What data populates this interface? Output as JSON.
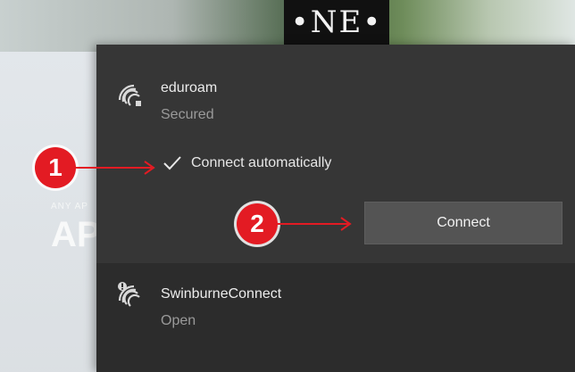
{
  "background": {
    "sign_text": "•NE•",
    "building_small": "ANY AP",
    "building_big": "AP"
  },
  "networks": [
    {
      "name": "eduroam",
      "status": "Secured",
      "icon": "wifi-signal-icon",
      "selected": true,
      "connect_automatically": {
        "label": "Connect automatically",
        "checked": true
      },
      "connect_button": "Connect"
    },
    {
      "name": "SwinburneConnect",
      "status": "Open",
      "icon": "wifi-open-warning-icon",
      "selected": false
    }
  ],
  "callouts": [
    {
      "number": "1"
    },
    {
      "number": "2"
    }
  ],
  "colors": {
    "panel_bg": "#2c2c2c",
    "selected_bg": "#363636",
    "button_bg": "#545454",
    "callout_red": "#e31b23"
  }
}
